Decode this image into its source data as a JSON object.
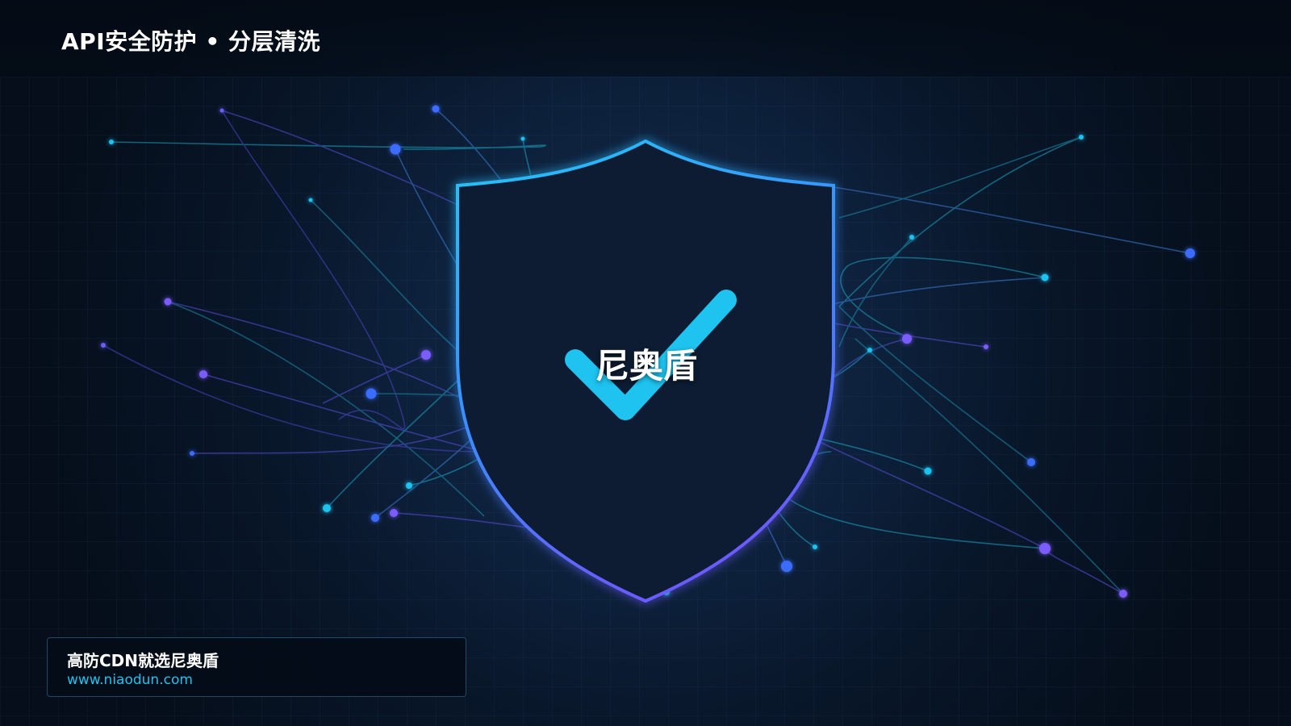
{
  "header": {
    "title": "API安全防护 • 分层清洗"
  },
  "shield": {
    "brand_text": "尼奥盾"
  },
  "card": {
    "title": "高防CDN就选尼奥盾",
    "url": "www.niaodun.com"
  },
  "colors": {
    "background": "#05101d",
    "cyan": "#1ec3f0",
    "violet": "#6a5cff",
    "check": "#1ec3f0",
    "card_border": "#1c4a68"
  },
  "icons": {
    "shield": "shield-icon",
    "check": "checkmark-icon"
  }
}
